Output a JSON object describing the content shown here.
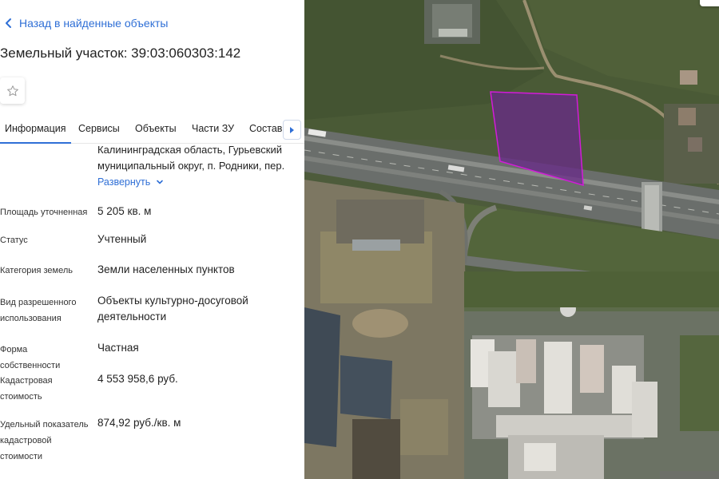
{
  "panel": {
    "back_link": "Назад в найденные объекты",
    "title": "Земельный участок: 39:03:060303:142",
    "favorite_icon": "star-icon",
    "tabs": [
      {
        "label": "Информация",
        "active": true
      },
      {
        "label": "Сервисы",
        "active": false
      },
      {
        "label": "Объекты",
        "active": false
      },
      {
        "label": "Части ЗУ",
        "active": false
      },
      {
        "label": "Состав",
        "active": false
      }
    ],
    "address_text": "Калининградская область, Гурьевский муниципальный округ, п. Родники, пер.",
    "expand_link": "Развернуть",
    "rows": [
      {
        "label": "Площадь уточненная",
        "value": "5 205 кв. м"
      },
      {
        "label": "Статус",
        "value": "Учтенный"
      },
      {
        "label": "Категория земель",
        "value": "Земли населенных пунктов"
      },
      {
        "label": "Вид разрешенного использования",
        "value": "Объекты культурно-досуговой деятельности"
      },
      {
        "label": "Форма собственности",
        "value": "Частная"
      },
      {
        "label": "Кадастровая стоимость",
        "value": "4 553 958,6 руб."
      },
      {
        "label": "Удельный показатель кадастровой стоимости",
        "value": "874,92 руб./кв. м"
      }
    ]
  },
  "colors": {
    "accent": "#2f6fd6",
    "parcel_stroke": "#d21bd8",
    "parcel_fill": "#6a2a8a"
  }
}
